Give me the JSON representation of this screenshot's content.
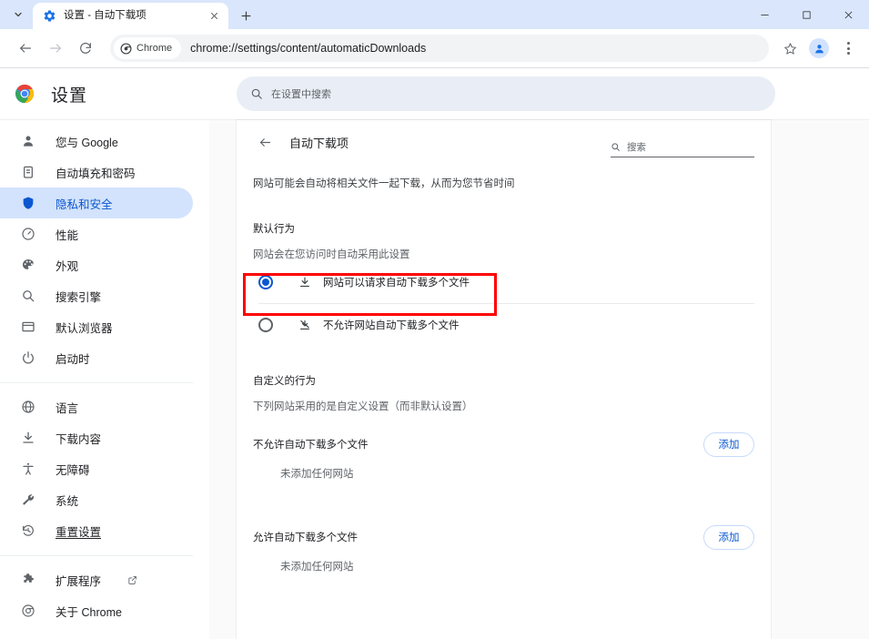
{
  "window": {
    "tab_search_icon": "chevron-down-icon",
    "tab": {
      "favicon": "settings-gear-icon",
      "title": "设置 - 自动下载项",
      "close_icon": "close-icon"
    },
    "new_tab_label": "+",
    "controls": {
      "minimize": "minimize-icon",
      "maximize": "maximize-icon",
      "close": "close-icon"
    }
  },
  "toolbar": {
    "back_icon": "arrow-left-icon",
    "forward_icon": "arrow-right-icon",
    "reload_icon": "reload-icon",
    "chip_label": "Chrome",
    "url": "chrome://settings/content/automaticDownloads",
    "bookmark_icon": "star-icon",
    "profile_icon": "avatar-icon",
    "menu_icon": "three-dots-icon"
  },
  "settings_header": {
    "title": "设置",
    "search_placeholder": "在设置中搜索",
    "search_icon": "search-icon"
  },
  "sidebar": {
    "groups": [
      {
        "items": [
          {
            "label": "您与 Google",
            "icon": "person-icon",
            "active": false
          },
          {
            "label": "自动填充和密码",
            "icon": "clipboard-icon",
            "active": false
          },
          {
            "label": "隐私和安全",
            "icon": "shield-icon",
            "active": true
          },
          {
            "label": "性能",
            "icon": "speedometer-icon",
            "active": false
          },
          {
            "label": "外观",
            "icon": "palette-icon",
            "active": false
          },
          {
            "label": "搜索引擎",
            "icon": "search-icon",
            "active": false
          },
          {
            "label": "默认浏览器",
            "icon": "window-icon",
            "active": false
          },
          {
            "label": "启动时",
            "icon": "power-icon",
            "active": false
          }
        ]
      },
      {
        "items": [
          {
            "label": "语言",
            "icon": "globe-icon",
            "active": false
          },
          {
            "label": "下载内容",
            "icon": "download-icon",
            "active": false
          },
          {
            "label": "无障碍",
            "icon": "accessibility-icon",
            "active": false
          },
          {
            "label": "系统",
            "icon": "wrench-icon",
            "active": false
          },
          {
            "label": "重置设置",
            "icon": "history-icon",
            "active": false,
            "underline": true
          }
        ]
      },
      {
        "items": [
          {
            "label": "扩展程序",
            "icon": "puzzle-icon",
            "active": false,
            "external": true
          },
          {
            "label": "关于 Chrome",
            "icon": "chrome-logo-icon",
            "active": false
          }
        ]
      }
    ]
  },
  "content": {
    "back_icon": "arrow-left-icon",
    "title": "自动下载项",
    "search_icon": "search-icon",
    "search_placeholder": "搜索",
    "description": "网站可能会自动将相关文件一起下载，从而为您节省时间",
    "default_behavior_label": "默认行为",
    "default_behavior_sub": "网站会在您访问时自动采用此设置",
    "radio_options": [
      {
        "label": "网站可以请求自动下载多个文件",
        "icon": "download-icon",
        "selected": true,
        "highlighted": true
      },
      {
        "label": "不允许网站自动下载多个文件",
        "icon": "download-off-icon",
        "selected": false,
        "highlighted": false
      }
    ],
    "custom_behavior_label": "自定义的行为",
    "custom_behavior_sub": "下列网站采用的是自定义设置（而非默认设置）",
    "lists": [
      {
        "label": "不允许自动下载多个文件",
        "add_label": "添加",
        "empty_note": "未添加任何网站"
      },
      {
        "label": "允许自动下载多个文件",
        "add_label": "添加",
        "empty_note": "未添加任何网站"
      }
    ]
  },
  "colors": {
    "accent": "#0b57d0",
    "active_pill": "#d3e3fd",
    "titlebar": "#d9e6fb",
    "highlight_rect": "#ff0000"
  }
}
